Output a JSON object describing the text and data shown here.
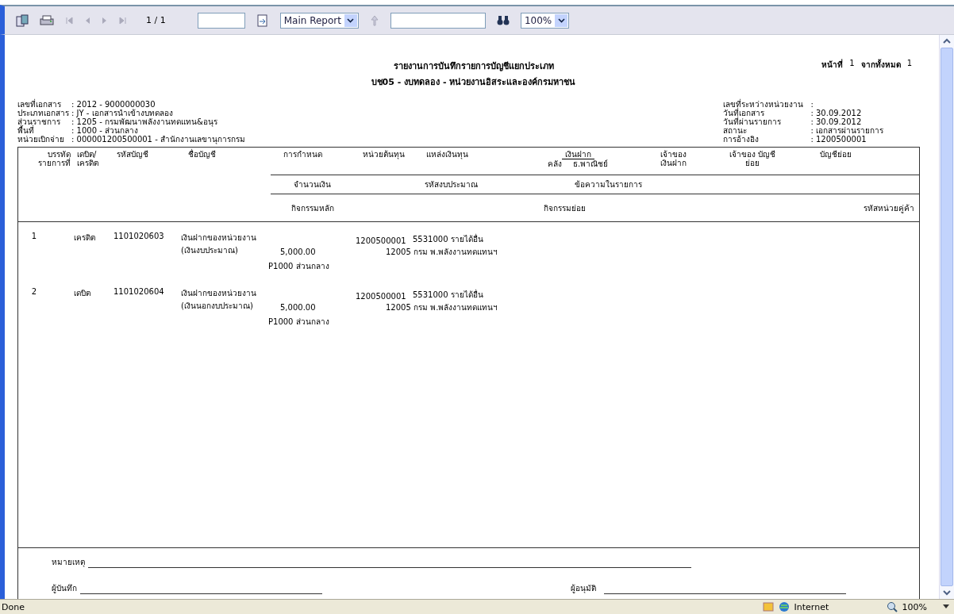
{
  "toolbar": {
    "page_indicator": "1 / 1",
    "report_select": "Main Report",
    "zoom_select": "100%"
  },
  "report": {
    "title": "รายงานการบันทึกรายการบัญชีแยกประเภท",
    "subtitle": "บช05 - งบทดลอง  - หน่วยงานอิสระและองค์กรมหาชน",
    "page_label": "หน้าที่",
    "page_no": "1",
    "total_label": "จากทั้งหมด",
    "total_pages": "1",
    "left_info": [
      {
        "label": "เลขที่เอกสาร",
        "value": ": 2012 - 9000000030"
      },
      {
        "label": "ประเภทเอกสาร",
        "value": ": JY - เอกสารนำเข้างบทดลอง"
      },
      {
        "label": "ส่วนราชการ",
        "value": ": 1205 - กรมพัฒนาพลังงานทดแทน&อนุร"
      },
      {
        "label": "พื้นที่",
        "value": ": 1000 - ส่วนกลาง"
      },
      {
        "label": "หน่วยเบิกจ่าย",
        "value": ": 000001200500001 - สำนักงานเลขานุการกรม"
      }
    ],
    "right_info": [
      {
        "label": "เลขที่ระหว่างหน่วยงาน",
        "value": ":"
      },
      {
        "label": "วันที่เอกสาร",
        "value": ": 30.09.2012"
      },
      {
        "label": "วันที่ผ่านรายการ",
        "value": ": 30.09.2012"
      },
      {
        "label": "สถานะ",
        "value": ": เอกสารผ่านรายการ"
      },
      {
        "label": "การอ้างอิง",
        "value": ": 1200500001"
      }
    ],
    "header_row_1": [
      "บรรทัด รายการที่",
      "เดบิต/ เครดิต",
      "รหัสบัญชี",
      "ชื่อบัญชี",
      "การกำหนด",
      "หน่วยต้นทุน",
      "แหล่งเงินทุน"
    ],
    "deposit_header": {
      "top": "เงินฝาก",
      "left": "คลัง",
      "right": "ธ.พาณิชย์"
    },
    "header_row_1_end": [
      "เจ้าของ เงินฝาก",
      "เจ้าของ บัญชีย่อย",
      "บัญชีย่อย"
    ],
    "header_row_2": [
      "จำนวนเงิน",
      "รหัสงบประมาณ",
      "ข้อความในรายการ"
    ],
    "header_row_3": [
      "กิจกรรมหลัก",
      "กิจกรรมย่อย",
      "รหัสหน่วยคู่ค้า"
    ],
    "rows": [
      {
        "line": "1",
        "dc": "เครดิต",
        "account": "1101020603",
        "name": "เงินฝากของหน่วยงาน (เงินงบประมาณ)",
        "cost_center": "1200500001",
        "fund": "5531000  รายได้อื่น",
        "amount": "5,000.00",
        "budget_code": "12005  กรม พ.พลังงานทดแทนฯ",
        "main_activity": "P1000  ส่วนกลาง"
      },
      {
        "line": "2",
        "dc": "เดบิต",
        "account": "1101020604",
        "name": "เงินฝากของหน่วยงาน (เงินนอกงบประมาณ)",
        "cost_center": "1200500001",
        "fund": "5531000  รายได้อื่น",
        "amount": "5,000.00",
        "budget_code": "12005  กรม พ.พลังงานทดแทนฯ",
        "main_activity": "P1000  ส่วนกลาง"
      }
    ],
    "remarks_label": "หมายเหตุ",
    "recorder_label": "ผู้บันทึก",
    "approver_label": "ผู้อนุมัติ"
  },
  "status_bar": {
    "status": "Done",
    "zone": "Internet",
    "zoom": "100%"
  }
}
